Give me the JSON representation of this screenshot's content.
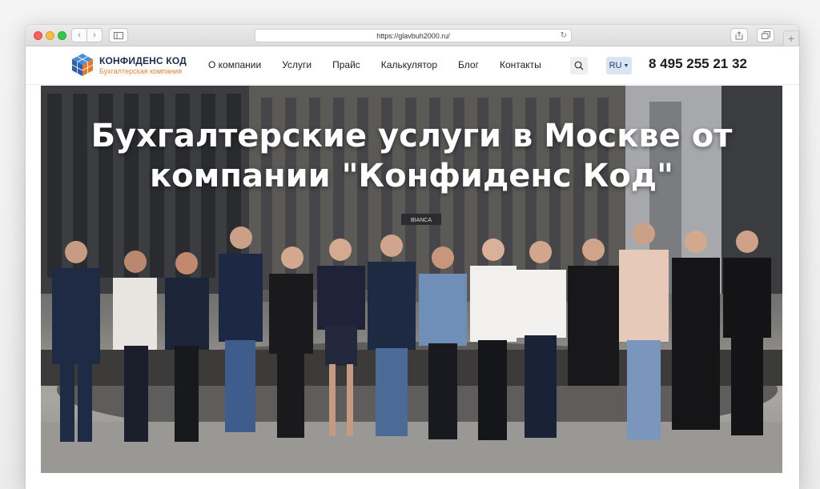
{
  "browser": {
    "url": "https://glavbuh2000.ru/",
    "reload_glyph": "↻",
    "back_glyph": "‹",
    "forward_glyph": "›",
    "new_tab_glyph": "+"
  },
  "site": {
    "logo": {
      "name": "КОНФИДЕНС КОД",
      "subtitle": "Бухгалтерская компания"
    },
    "menu": [
      {
        "label": "О компании"
      },
      {
        "label": "Услуги"
      },
      {
        "label": "Прайс"
      },
      {
        "label": "Калькулятор"
      },
      {
        "label": "Блог"
      },
      {
        "label": "Контакты"
      }
    ],
    "search_icon": "search-icon",
    "language": "RU",
    "language_arrow": "▼",
    "phone": "8 495 255 21 32"
  },
  "hero": {
    "title": "Бухгалтерские услуги в Москве от компании \"Конфиденс Код\"",
    "sign_text": "BIANCA"
  },
  "colors": {
    "brand_dark": "#1e2a4a",
    "brand_orange": "#e0813a",
    "lang_bg": "#d9e5f2"
  }
}
